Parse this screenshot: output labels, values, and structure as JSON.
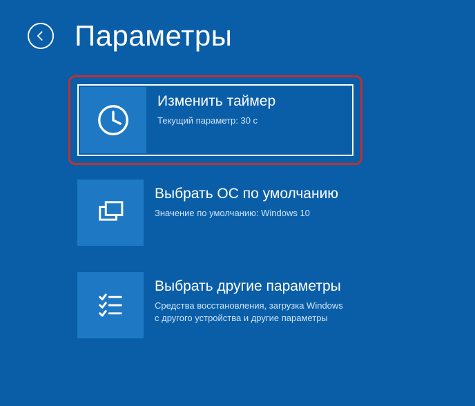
{
  "header": {
    "title": "Параметры"
  },
  "options": [
    {
      "title": "Изменить таймер",
      "subtitle": "Текущий параметр: 30 с",
      "icon": "clock-icon",
      "highlighted": true
    },
    {
      "title": "Выбрать ОС по умолчанию",
      "subtitle": "Значение по умолчанию: Windows 10",
      "icon": "windows-icon",
      "highlighted": false
    },
    {
      "title": "Выбрать другие параметры",
      "subtitle": "Средства восстановления, загрузка Windows с другого устройства и другие параметры",
      "icon": "checklist-icon",
      "highlighted": false
    }
  ],
  "colors": {
    "background": "#0a5ea8",
    "tile": "#1f78c4",
    "highlight": "#c12f2f"
  }
}
